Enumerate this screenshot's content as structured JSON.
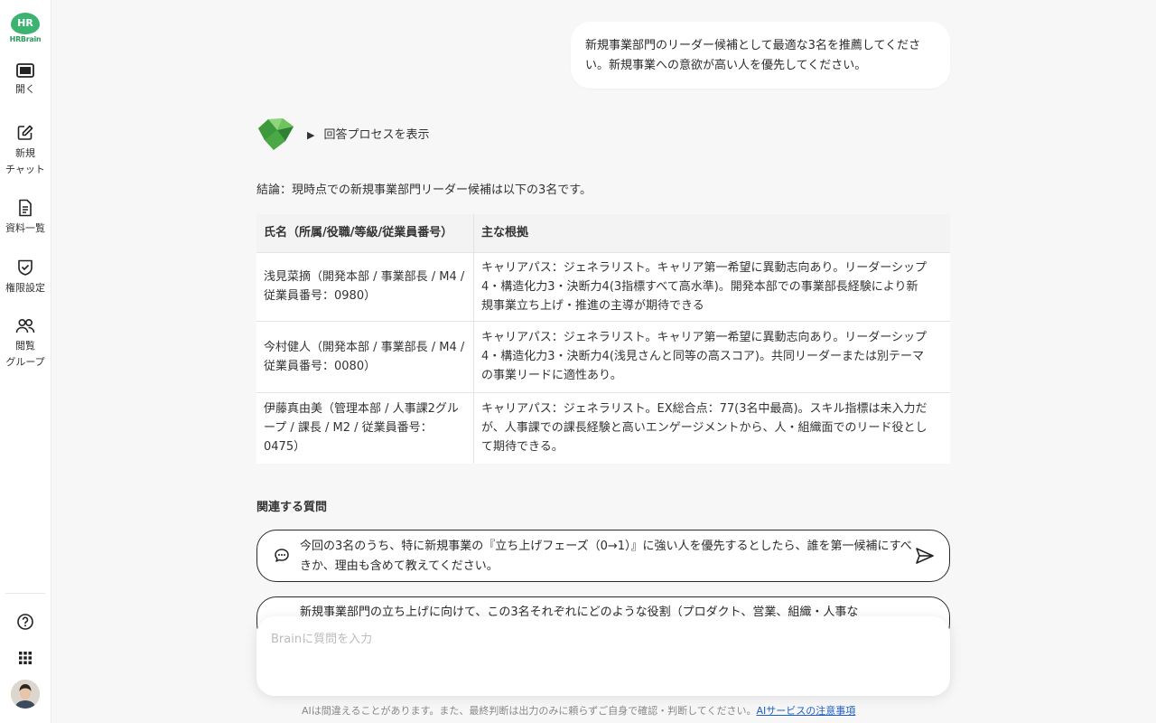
{
  "brand": {
    "logo_mark": "HR",
    "logo_text": "HRBrain",
    "color": "#3cb371"
  },
  "sidebar": {
    "items": [
      {
        "label": "開く",
        "icon": "panel-icon"
      },
      {
        "label": "新規\nチャット",
        "icon": "new-chat-icon"
      },
      {
        "label": "資料一覧",
        "icon": "document-icon"
      },
      {
        "label": "権限設定",
        "icon": "shield-check-icon"
      },
      {
        "label": "閲覧\nグループ",
        "icon": "users-icon"
      }
    ],
    "bottom_icons": [
      "help-icon",
      "apps-grid-icon",
      "user-avatar"
    ]
  },
  "chat": {
    "user_message": "新規事業部門のリーダー候補として最適な3名を推薦してください。新規事業への意欲が高い人を優先してください。",
    "process_toggle": "回答プロセスを表示",
    "conclusion": "結論：現時点での新規事業部門リーダー候補は以下の3名です。",
    "table": {
      "headers": [
        "氏名（所属/役職/等級/従業員番号）",
        "主な根拠"
      ],
      "rows": [
        {
          "name": "浅見菜摘（開発本部 / 事業部長 / M4 / 従業員番号：0980）",
          "reason": "キャリアパス：ジェネラリスト。キャリア第一希望に異動志向あり。リーダーシップ4・構造化力3・決断力4(3指標すべて高水準)。開発本部での事業部長経験により新規事業立ち上げ・推進の主導が期待できる"
        },
        {
          "name": "今村健人（開発本部 / 事業部長 / M4 / 従業員番号：0080）",
          "reason": "キャリアパス：ジェネラリスト。キャリア第一希望に異動志向あり。リーダーシップ4・構造化力3・決断力4(浅見さんと同等の高スコア)。共同リーダーまたは別テーマの事業リードに適性あり。"
        },
        {
          "name": "伊藤真由美（管理本部 / 人事課2グループ / 課長 / M2 / 従業員番号：0475）",
          "reason": "キャリアパス：ジェネラリスト。EX総合点：77(3名中最高)。スキル指標は未入力だが、人事課での課長経験と高いエンゲージメントから、人・組織面でのリード役として期待できる。"
        }
      ]
    },
    "related_title": "関連する質問",
    "suggestions": [
      "今回の3名のうち、特に新規事業の『立ち上げフェーズ（0→1）』に強い人を優先するとしたら、誰を第一候補にすべきか、理由も含めて教えてください。",
      "新規事業部門の立ち上げに向けて、この3名それぞれにどのような役割（プロダクト、営業、組織・人事な"
    ]
  },
  "input": {
    "placeholder": "Brainに質問を入力"
  },
  "footer": {
    "disclaimer": "AIは間違えることがあります。また、最終判断は出力のみに頼らずご自身で確認・判断してください。",
    "link": "AIサービスの注意事項"
  }
}
